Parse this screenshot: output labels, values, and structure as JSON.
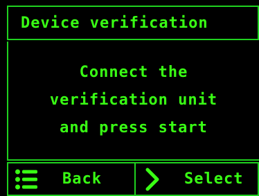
{
  "colors": {
    "accent": "#39ff14",
    "border": "#1fd11f",
    "background": "#000000"
  },
  "header": {
    "title": "Device verification"
  },
  "message": {
    "lines": [
      "Connect the",
      "verification unit",
      "and press start"
    ]
  },
  "softkeys": {
    "back": {
      "label": "Back",
      "icon": "menu-list-icon"
    },
    "select": {
      "label": "Select",
      "icon": "chevron-right-icon"
    }
  }
}
